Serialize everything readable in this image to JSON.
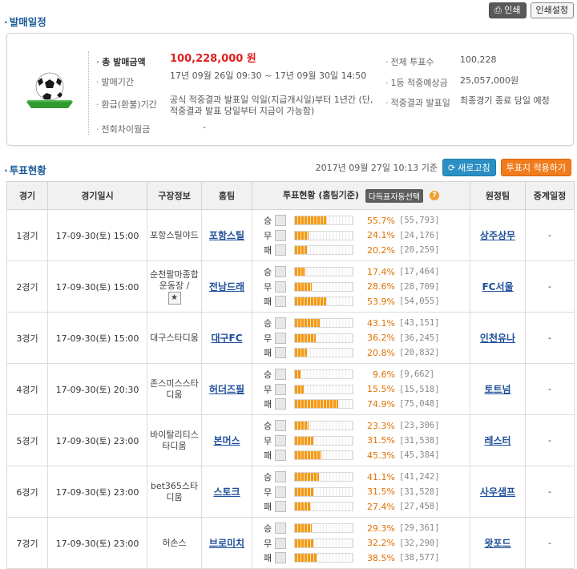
{
  "buttons": {
    "print": "인쇄",
    "print_settings": "인쇄설정",
    "refresh": "새로고침",
    "apply_slip": "투표지 적용하기"
  },
  "sale_section": {
    "title": "발매일정",
    "rows": [
      {
        "label": "총 발매금액",
        "value": "100,228,000 원"
      },
      {
        "label": "발매기간",
        "value": "17년 09월 26일 09:30 ~ 17년 09월 30일 14:50"
      },
      {
        "label": "환급(환불)기간",
        "value": "공식 적중결과 발표일 익일(지급개시일)부터 1년간 (단, 적중결과 발표 당일부터 지급이 가능함)"
      },
      {
        "label": "전회차이월금",
        "value": "-"
      },
      {
        "label": "전체 투표수",
        "value": "100,228"
      },
      {
        "label": "1등 적중예상금",
        "value": "25,057,000원"
      },
      {
        "label": "적중결과 발표일",
        "value": "최종경기 종료 당일 예정"
      }
    ]
  },
  "vote_section": {
    "title": "투표현황",
    "timestamp": "2017년 09월 27일 10:13 기준",
    "headers": {
      "game": "경기",
      "datetime": "경기일시",
      "stadium": "구장정보",
      "home": "홈팀",
      "votes": "투표현황 (홈팀기준)",
      "away": "원정팀",
      "broadcast": "중계일정"
    },
    "auto_select": "다득표자동선택",
    "help_icon": "?",
    "outcome_labels": [
      "승",
      "무",
      "패"
    ],
    "games": [
      {
        "no": "1경기",
        "datetime": "17-09-30(토) 15:00",
        "stadium": "포항스틸야드",
        "home": "포항스틸",
        "away": "상주상무",
        "broadcast": "-",
        "votes": [
          {
            "pct": "55.7%",
            "count": "[55,793]",
            "ratio": 0.557
          },
          {
            "pct": "24.1%",
            "count": "[24,176]",
            "ratio": 0.241
          },
          {
            "pct": "20.2%",
            "count": "[20,259]",
            "ratio": 0.202
          }
        ]
      },
      {
        "no": "2경기",
        "datetime": "17-09-30(토) 15:00",
        "stadium": "순천팔마종합운동장 /",
        "home": "전남드래",
        "away": "FC서울",
        "broadcast": "-",
        "star": "★",
        "votes": [
          {
            "pct": "17.4%",
            "count": "[17,464]",
            "ratio": 0.174
          },
          {
            "pct": "28.6%",
            "count": "[28,709]",
            "ratio": 0.286
          },
          {
            "pct": "53.9%",
            "count": "[54,055]",
            "ratio": 0.539
          }
        ]
      },
      {
        "no": "3경기",
        "datetime": "17-09-30(토) 15:00",
        "stadium": "대구스타디움",
        "home": "대구FC",
        "away": "인천유나",
        "broadcast": "-",
        "votes": [
          {
            "pct": "43.1%",
            "count": "[43,151]",
            "ratio": 0.431
          },
          {
            "pct": "36.2%",
            "count": "[36,245]",
            "ratio": 0.362
          },
          {
            "pct": "20.8%",
            "count": "[20,832]",
            "ratio": 0.208
          }
        ]
      },
      {
        "no": "4경기",
        "datetime": "17-09-30(토) 20:30",
        "stadium": "존스미스스타디움",
        "home": "허더즈필",
        "away": "토트넘",
        "broadcast": "-",
        "votes": [
          {
            "pct": "9.6%",
            "count": "[9,662]",
            "ratio": 0.096
          },
          {
            "pct": "15.5%",
            "count": "[15,518]",
            "ratio": 0.155
          },
          {
            "pct": "74.9%",
            "count": "[75,048]",
            "ratio": 0.749
          }
        ]
      },
      {
        "no": "5경기",
        "datetime": "17-09-30(토) 23:00",
        "stadium": "바이탈리티스타디움",
        "home": "본머스",
        "away": "레스터",
        "broadcast": "-",
        "votes": [
          {
            "pct": "23.3%",
            "count": "[23,306]",
            "ratio": 0.233
          },
          {
            "pct": "31.5%",
            "count": "[31,538]",
            "ratio": 0.315
          },
          {
            "pct": "45.3%",
            "count": "[45,384]",
            "ratio": 0.453
          }
        ]
      },
      {
        "no": "6경기",
        "datetime": "17-09-30(토) 23:00",
        "stadium": "bet365스타디움",
        "home": "스토크",
        "away": "사우샘프",
        "broadcast": "-",
        "votes": [
          {
            "pct": "41.1%",
            "count": "[41,242]",
            "ratio": 0.411
          },
          {
            "pct": "31.5%",
            "count": "[31,528]",
            "ratio": 0.315
          },
          {
            "pct": "27.4%",
            "count": "[27,458]",
            "ratio": 0.274
          }
        ]
      },
      {
        "no": "7경기",
        "datetime": "17-09-30(토) 23:00",
        "stadium": "허손스",
        "home": "브로미치",
        "away": "왓포드",
        "broadcast": "-",
        "votes": [
          {
            "pct": "29.3%",
            "count": "[29,361]",
            "ratio": 0.293
          },
          {
            "pct": "32.2%",
            "count": "[32,290]",
            "ratio": 0.322
          },
          {
            "pct": "38.5%",
            "count": "[38,577]",
            "ratio": 0.385
          }
        ]
      }
    ]
  },
  "colors": {
    "title": "#1e5c9a",
    "total_amount": "#e02020",
    "bar_fill": "#f39a18",
    "percent": "#e07000",
    "team_link": "#1f4f99"
  },
  "icons": {
    "ball": "soccer-ball-icon",
    "refresh": "refresh-icon",
    "print": "printer-icon",
    "help": "question-icon"
  }
}
